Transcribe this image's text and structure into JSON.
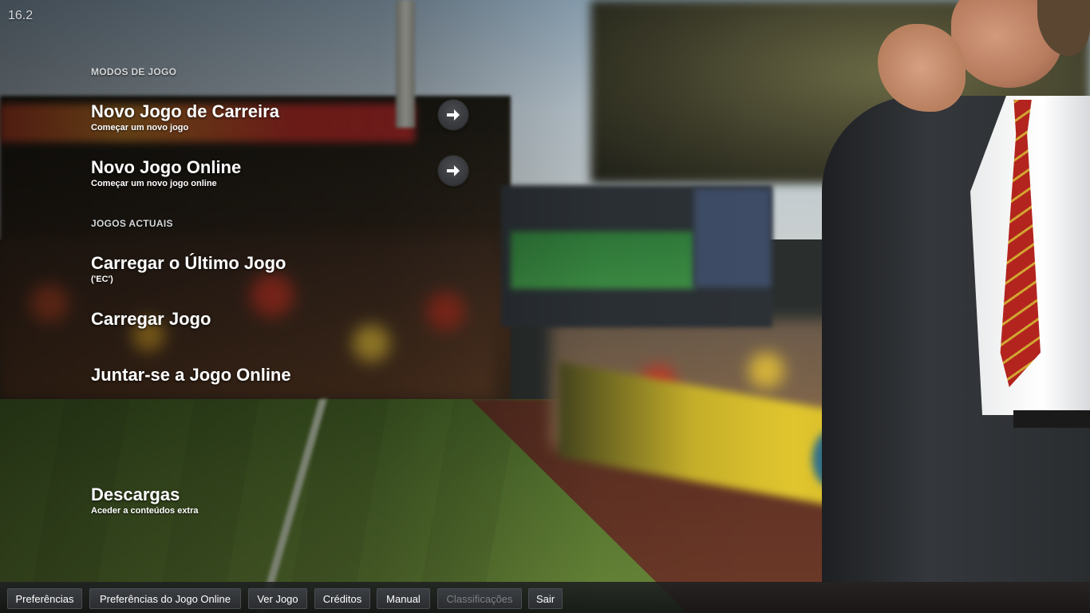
{
  "version": "16.2",
  "sections": {
    "game_modes": "MODOS DE JOGO",
    "current_games": "JOGOS ACTUAIS"
  },
  "menu": {
    "new_career": {
      "title": "Novo Jogo de Carreira",
      "subtitle": "Começar um novo jogo"
    },
    "new_online": {
      "title": "Novo Jogo Online",
      "subtitle": "Começar um novo jogo online"
    },
    "load_last": {
      "title": "Carregar o Último Jogo",
      "subtitle": "('EC')"
    },
    "load_game": {
      "title": "Carregar Jogo"
    },
    "join_online": {
      "title": "Juntar-se a Jogo Online"
    },
    "downloads": {
      "title": "Descargas",
      "subtitle": "Aceder a conteúdos extra"
    }
  },
  "bottom_bar": {
    "preferences": "Preferências",
    "online_preferences": "Preferências do Jogo Online",
    "view_game": "Ver Jogo",
    "credits": "Créditos",
    "manual": "Manual",
    "rankings": "Classificações",
    "quit": "Sair"
  },
  "colors": {
    "arrow_button": "#2f3134",
    "bottom_bar": "#1e2022",
    "disabled_text": "#7d8185"
  },
  "icons": {
    "arrow": "arrow-right-icon"
  }
}
